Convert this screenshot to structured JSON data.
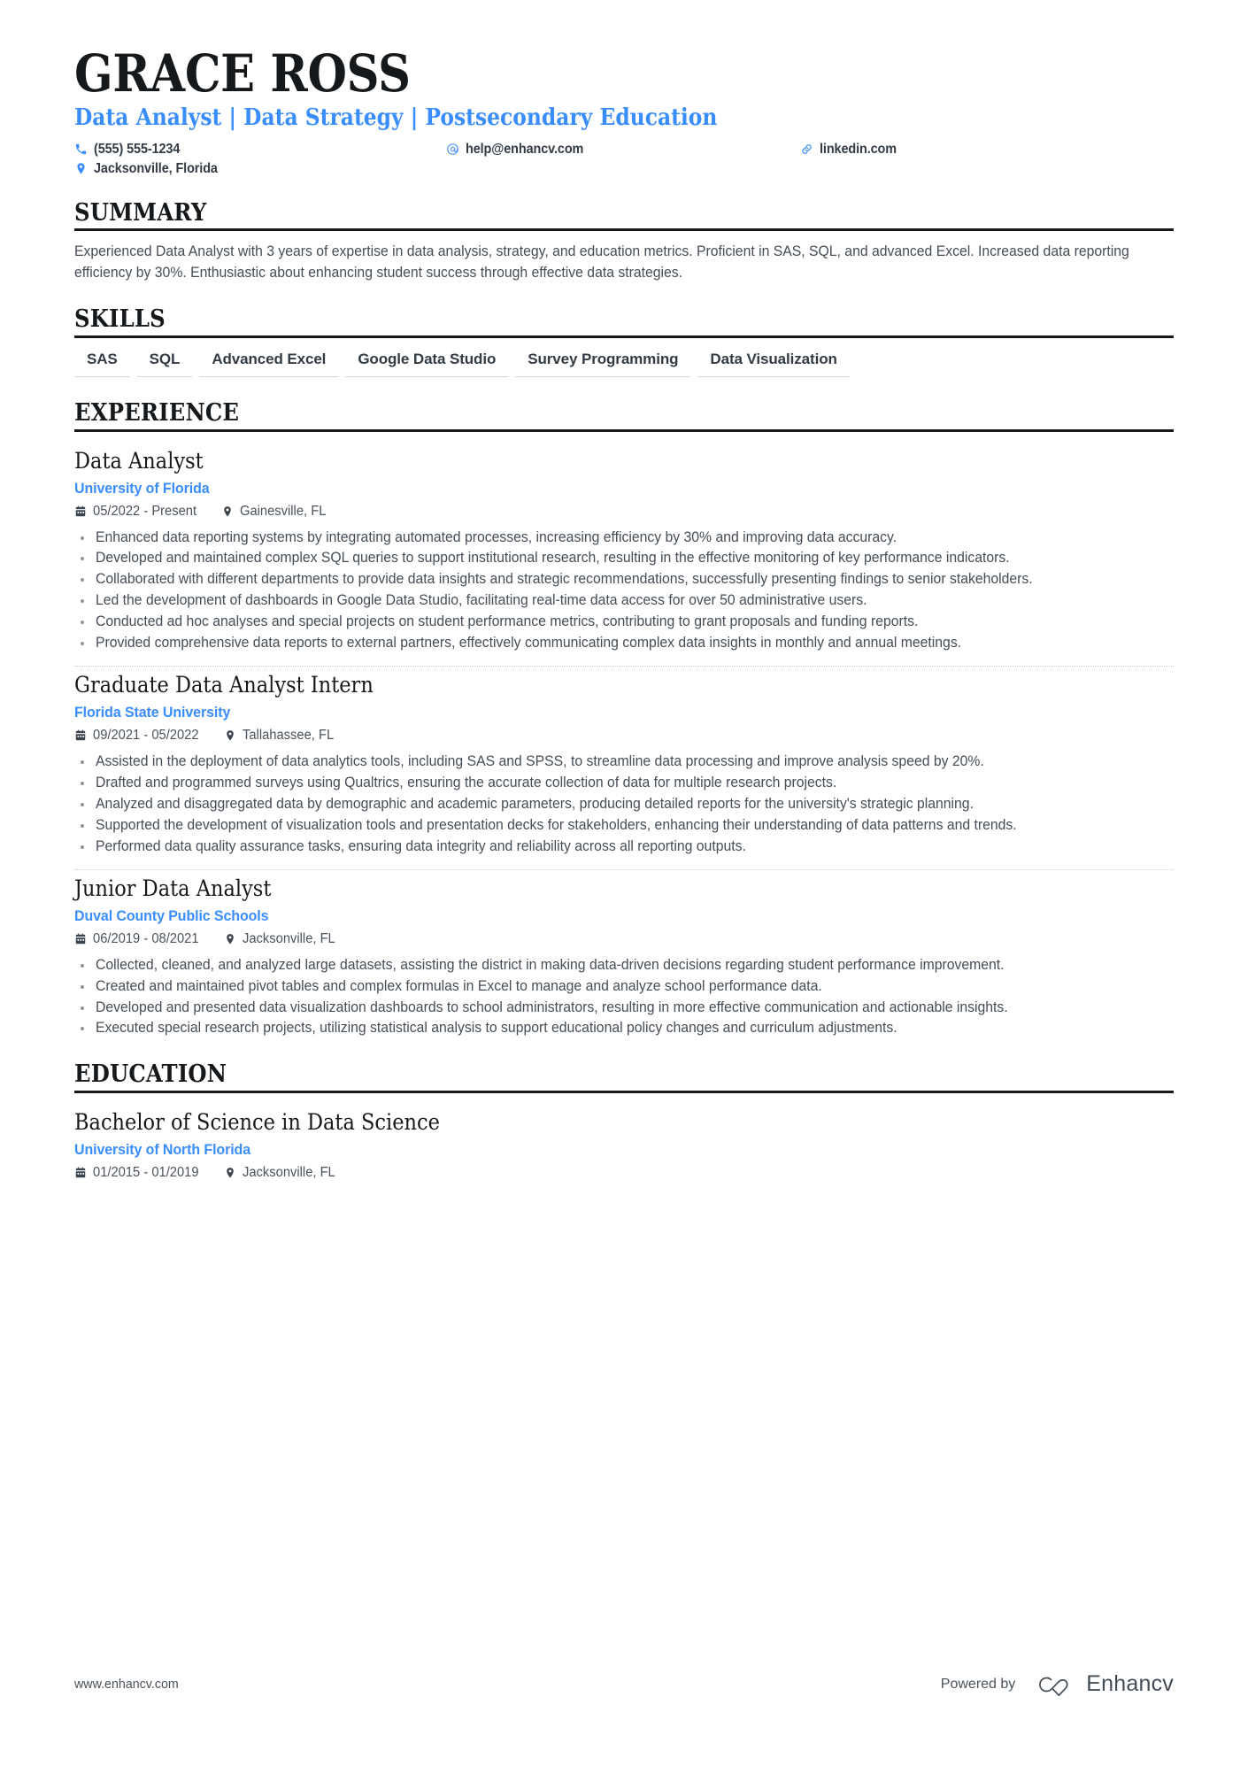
{
  "header": {
    "name": "GRACE ROSS",
    "headline": "Data Analyst | Data Strategy | Postsecondary Education",
    "contacts": [
      {
        "icon": "phone-icon",
        "text": "(555) 555-1234"
      },
      {
        "icon": "email-icon",
        "text": "help@enhancv.com"
      },
      {
        "icon": "link-icon",
        "text": "linkedin.com"
      },
      {
        "icon": "location-icon",
        "text": "Jacksonville, Florida"
      }
    ]
  },
  "sections": {
    "summary": {
      "title": "SUMMARY",
      "text": "Experienced Data Analyst with 3 years of expertise in data analysis, strategy, and education metrics. Proficient in SAS, SQL, and advanced Excel. Increased data reporting efficiency by 30%. Enthusiastic about enhancing student success through effective data strategies."
    },
    "skills": {
      "title": "SKILLS",
      "items": [
        "SAS",
        "SQL",
        "Advanced Excel",
        "Google Data Studio",
        "Survey Programming",
        "Data Visualization"
      ]
    },
    "experience": {
      "title": "EXPERIENCE",
      "entries": [
        {
          "role": "Data Analyst",
          "organization": "University of Florida",
          "dates": "05/2022 - Present",
          "location": "Gainesville, FL",
          "bullets": [
            "Enhanced data reporting systems by integrating automated processes, increasing efficiency by 30% and improving data accuracy.",
            "Developed and maintained complex SQL queries to support institutional research, resulting in the effective monitoring of key performance indicators.",
            "Collaborated with different departments to provide data insights and strategic recommendations, successfully presenting findings to senior stakeholders.",
            "Led the development of dashboards in Google Data Studio, facilitating real-time data access for over 50 administrative users.",
            "Conducted ad hoc analyses and special projects on student performance metrics, contributing to grant proposals and funding reports.",
            "Provided comprehensive data reports to external partners, effectively communicating complex data insights in monthly and annual meetings."
          ]
        },
        {
          "role": "Graduate Data Analyst Intern",
          "organization": "Florida State University",
          "dates": "09/2021 - 05/2022",
          "location": "Tallahassee, FL",
          "bullets": [
            "Assisted in the deployment of data analytics tools, including SAS and SPSS, to streamline data processing and improve analysis speed by 20%.",
            "Drafted and programmed surveys using Qualtrics, ensuring the accurate collection of data for multiple research projects.",
            "Analyzed and disaggregated data by demographic and academic parameters, producing detailed reports for the university's strategic planning.",
            "Supported the development of visualization tools and presentation decks for stakeholders, enhancing their understanding of data patterns and trends.",
            "Performed data quality assurance tasks, ensuring data integrity and reliability across all reporting outputs."
          ]
        },
        {
          "role": "Junior Data Analyst",
          "organization": "Duval County Public Schools",
          "dates": "06/2019 - 08/2021",
          "location": "Jacksonville, FL",
          "bullets": [
            "Collected, cleaned, and analyzed large datasets, assisting the district in making data-driven decisions regarding student performance improvement.",
            "Created and maintained pivot tables and complex formulas in Excel to manage and analyze school performance data.",
            "Developed and presented data visualization dashboards to school administrators, resulting in more effective communication and actionable insights.",
            "Executed special research projects, utilizing statistical analysis to support educational policy changes and curriculum adjustments."
          ]
        }
      ]
    },
    "education": {
      "title": "EDUCATION",
      "entries": [
        {
          "degree": "Bachelor of Science in Data Science",
          "organization": "University of North Florida",
          "dates": "01/2015 - 01/2019",
          "location": "Jacksonville, FL"
        }
      ]
    }
  },
  "footer": {
    "url": "www.enhancv.com",
    "powered_by_label": "Powered by",
    "brand_name": "Enhancv"
  },
  "colors": {
    "accent_blue": "#3a8dfc",
    "text_dark": "#16191c",
    "text_body": "#454d56",
    "rule": "#16191c",
    "skill_underline": "#d5d9dd"
  }
}
